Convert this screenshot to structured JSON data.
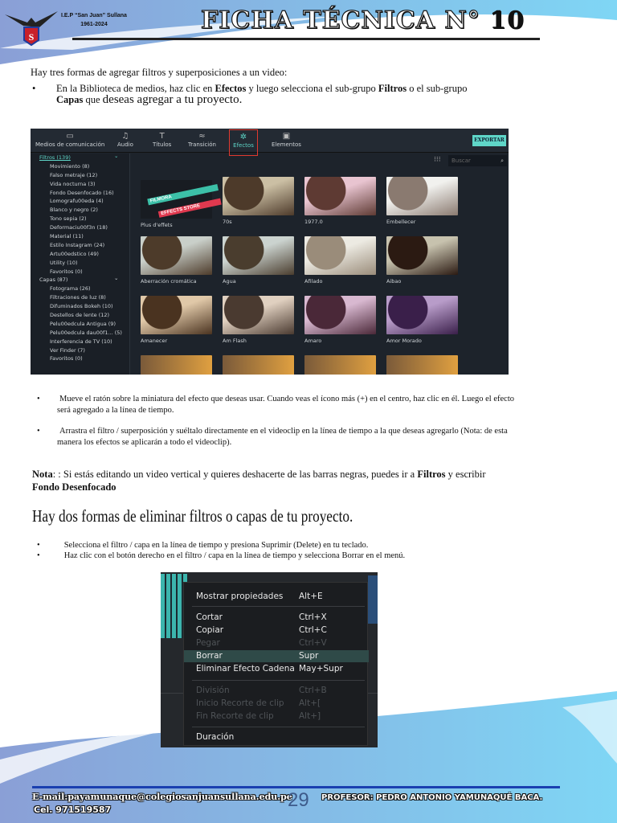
{
  "header": {
    "school": "I.E.P “San Juan”  Sullana",
    "years": "1961-2024",
    "title": "FICHA TÉCNICA N°",
    "number": "10"
  },
  "intro": "Hay tres formas de agregar filtros y superposiciones a un video:",
  "bullet1": {
    "a": "En la Biblioteca de medios, haz clic en ",
    "b": "Efectos",
    "c": " y luego selecciona el sub-grupo ",
    "d": "Filtros",
    "e": " o el sub-grupo ",
    "f": "Capas",
    "g": " que ",
    "h": "deseas agregar a tu proyecto."
  },
  "editor": {
    "toolbar": [
      {
        "icon": "folder-icon",
        "label": "Medios de comunicación"
      },
      {
        "icon": "music-icon",
        "label": "Audio"
      },
      {
        "icon": "text-icon",
        "label": "Títulos"
      },
      {
        "icon": "transition-icon",
        "label": "Transición"
      },
      {
        "icon": "effects-icon",
        "label": "Efectos"
      },
      {
        "icon": "image-icon",
        "label": "Elementos"
      }
    ],
    "export": "EXPORTAR",
    "search_placeholder": "Buscar",
    "sidebar": [
      "Filtros (139)",
      "Movimiento (8)",
      "Falso metraje (12)",
      "Vida nocturna (3)",
      "Fondo Desenfocado (16)",
      "Lomografu00eda (4)",
      "Blanco y negro (2)",
      "Tono sepia (2)",
      "Deformaciu00f3n (18)",
      "Material (11)",
      "Estilo Instagram (24)",
      "Artu00edstico (49)",
      "Utility (10)",
      "Favoritos (0)",
      "Capas (87)",
      "Fotograma (26)",
      "Filtraciones de luz (8)",
      "Difuminados Bokeh (10)",
      "Destellos de lente (12)",
      "Pelu00edcula Antigua (9)",
      "Pelu00edcula dau00f1... (5)",
      "Interferencia de TV (10)",
      "Ver Finder (7)",
      "Favoritos (0)"
    ],
    "store_banner": [
      "FILMORA",
      "EFFECTS STORE"
    ],
    "thumbs": [
      "Plus d'effets",
      "70s",
      "1977.0",
      "Embellecer",
      "Aberración cromática",
      "Agua",
      "Afilado",
      "Aibao",
      "Amanecer",
      "Am Flash",
      "Amaro",
      "Amor Morado"
    ]
  },
  "bullet2": "Mueve el ratón sobre la miniatura del efecto que deseas usar. Cuando veas el ícono más (+) en el centro, haz clic en él. Luego el efecto será agregado a la línea de tiempo.",
  "bullet3": "Arrastra el filtro / superposición y suéltalo directamente en el videoclip en la línea de tiempo a la que deseas agregarlo (Nota: de esta manera los efectos se aplicarán a todo el videoclip).",
  "note": {
    "label": "Nota",
    "a": ": : Si estás editando un video vertical y quieres deshacerte de las barras negras, puedes ir a ",
    "b": "Filtros",
    "c": " y escribir ",
    "d": "Fondo  Desenfocado"
  },
  "heading2": "Hay dos formas de eliminar filtros o capas de tu proyecto.",
  "bullet4": "Selecciona el filtro / capa en la línea de tiempo y presiona Suprimir (Delete) en tu teclado.",
  "bullet5": "Haz clic con el botón derecho en el filtro / capa en la línea de tiempo y selecciona Borrar en el menú.",
  "menu": [
    {
      "label": "Mostrar propiedades",
      "key": "Alt+E"
    },
    {
      "label": "Cortar",
      "key": "Ctrl+X"
    },
    {
      "label": "Copiar",
      "key": "Ctrl+C"
    },
    {
      "label": "Pegar",
      "key": "Ctrl+V"
    },
    {
      "label": "Borrar",
      "key": "Supr"
    },
    {
      "label": "Eliminar Efecto Cadena",
      "key": "May+Supr"
    },
    {
      "label": "División",
      "key": "Ctrl+B"
    },
    {
      "label": "Inicio Recorte de clip",
      "key": "Alt+["
    },
    {
      "label": "Fin Recorte de clip",
      "key": "Alt+]"
    },
    {
      "label": "Duración",
      "key": ""
    }
  ],
  "footer": {
    "email": "E-mail:payamunaque@colegiosanjuansullana.edu.pe",
    "cel": "Cel. 971519587",
    "page": "29",
    "teacher": "PROFESOR: PEDRO ANTONIO YAMUNAQUÉ BACA."
  }
}
